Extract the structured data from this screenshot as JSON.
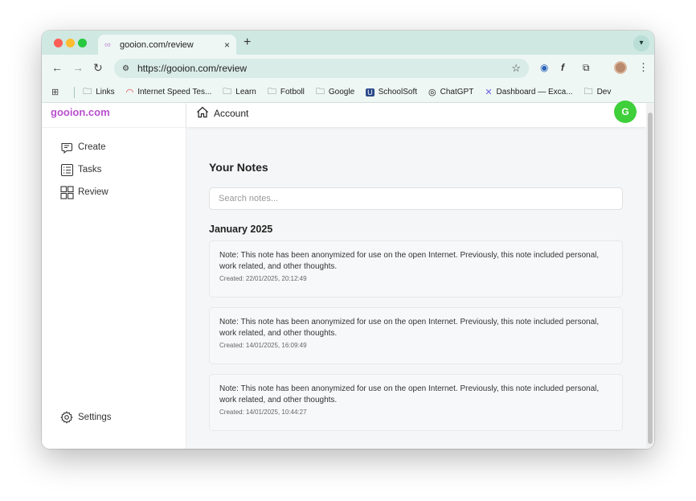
{
  "browser": {
    "tab_title": "gooion.com/review",
    "new_tab": "+",
    "tab_close": "×",
    "url": "https://gooion.com/review",
    "bookmarks": [
      {
        "label": "Links",
        "icon": "folder-icon"
      },
      {
        "label": "Internet Speed Tes...",
        "icon": "speedometer-icon"
      },
      {
        "label": "Learn",
        "icon": "folder-icon"
      },
      {
        "label": "Fotboll",
        "icon": "folder-icon"
      },
      {
        "label": "Google",
        "icon": "folder-icon"
      },
      {
        "label": "SchoolSoft",
        "icon": "schoolsoft-icon"
      },
      {
        "label": "ChatGPT",
        "icon": "chatgpt-icon"
      },
      {
        "label": "Dashboard — Exca...",
        "icon": "excalidraw-icon"
      },
      {
        "label": "Dev",
        "icon": "folder-icon"
      }
    ]
  },
  "sidebar": {
    "brand": "gooion.com",
    "brand_color": "#b94fd0",
    "items": [
      {
        "label": "Create",
        "icon": "create-note-icon"
      },
      {
        "label": "Tasks",
        "icon": "tasks-list-icon"
      },
      {
        "label": "Review",
        "icon": "grid-icon"
      }
    ],
    "settings": {
      "label": "Settings",
      "icon": "gear-icon"
    }
  },
  "header": {
    "account_label": "Account",
    "avatar_initial": "G",
    "avatar_color": "#3fcf3a"
  },
  "main": {
    "title": "Your Notes",
    "search_placeholder": "Search notes...",
    "month": "January 2025",
    "notes": [
      {
        "text": "Note: This note has been anonymized for use on the open Internet. Previously, this note included personal, work related, and other thoughts.",
        "created": "Created: 22/01/2025, 20:12:49"
      },
      {
        "text": "Note: This note has been anonymized for use on the open Internet. Previously, this note included personal, work related, and other thoughts.",
        "created": "Created: 14/01/2025, 16:09:49"
      },
      {
        "text": "Note: This note has been anonymized for use on the open Internet. Previously, this note included personal, work related, and other thoughts.",
        "created": "Created: 14/01/2025, 10:44:27"
      }
    ]
  }
}
